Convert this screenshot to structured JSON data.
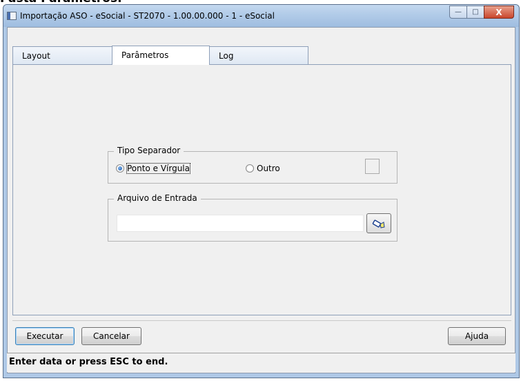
{
  "document": {
    "heading": "Pasta Parâmetros:"
  },
  "window": {
    "title": "Importação ASO - eSocial - ST2070 - 1.00.00.000 - 1 - eSocial",
    "controls": {
      "minimize": "—",
      "maximize": "□",
      "close": "X"
    }
  },
  "tabs": [
    {
      "label": "Layout",
      "active": false
    },
    {
      "label": "Parâmetros",
      "active": true
    },
    {
      "label": "Log",
      "active": false
    }
  ],
  "separator_group": {
    "title": "Tipo Separador",
    "options": [
      {
        "label": "Ponto e Vírgula",
        "checked": true
      },
      {
        "label": "Outro",
        "checked": false
      }
    ],
    "other_value": ""
  },
  "input_group": {
    "title": "Arquivo de Entrada",
    "file_value": "",
    "browse_icon": "flashlight-search-icon"
  },
  "buttons": {
    "execute": "Executar",
    "cancel": "Cancelar",
    "help": "Ajuda"
  },
  "status": {
    "message": "Enter data or press ESC to end."
  }
}
